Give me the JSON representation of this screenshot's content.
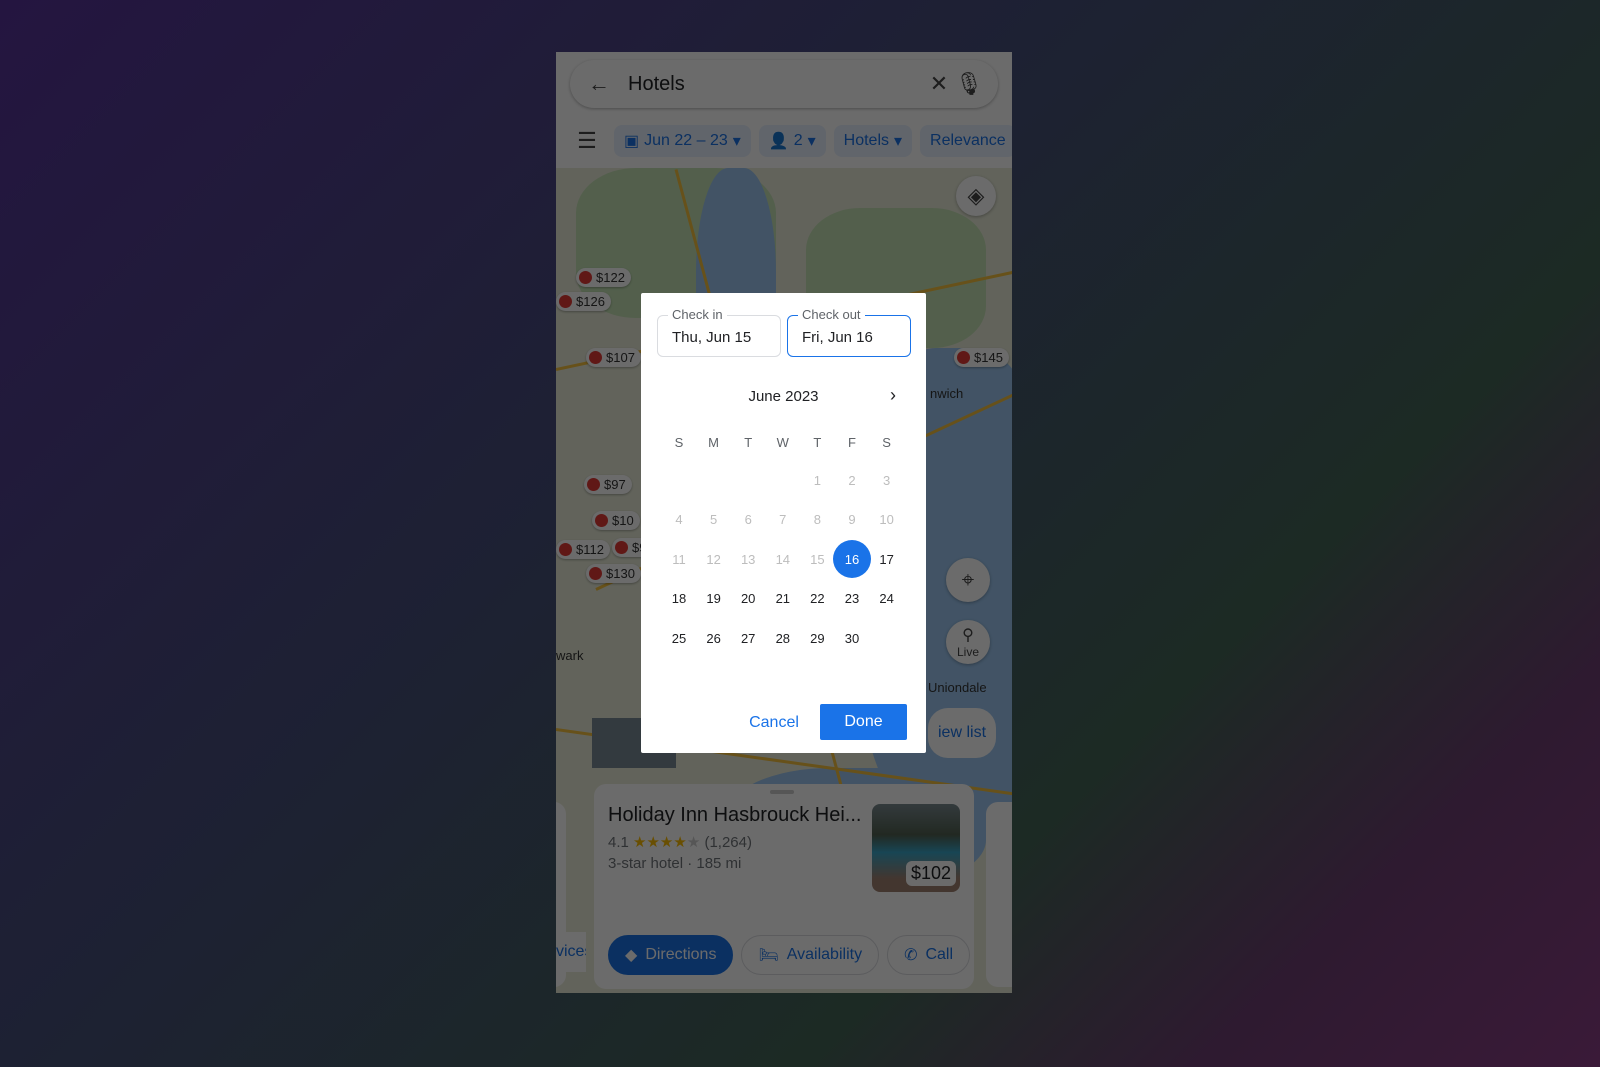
{
  "search": {
    "query": "Hotels",
    "back_icon": "arrow-left-icon",
    "clear_icon": "close-icon",
    "mic_icon": "mic-icon"
  },
  "chips": [
    {
      "label": "Jun 22 – 23",
      "icon": "calendar-icon"
    },
    {
      "label": "2",
      "icon": "person-icon"
    },
    {
      "label": "Hotels"
    },
    {
      "label": "Relevance"
    }
  ],
  "map": {
    "pins": [
      "$122",
      "$126",
      "$107",
      "$145",
      "$97",
      "$10",
      "$112",
      "$9",
      "$130"
    ],
    "labels": [
      "nwich",
      "wark",
      "Uniondale"
    ],
    "live_label": "Live",
    "view_list": "iew list"
  },
  "card": {
    "name": "Holiday Inn Hasbrouck Hei...",
    "rating": "4.1",
    "stars": "★★★★",
    "star_empty": "★",
    "reviews": "(1,264)",
    "subtitle": "3-star hotel · 185 mi",
    "price": "$102",
    "actions": {
      "partial": "vices",
      "directions": "Directions",
      "availability": "Availability",
      "call": "Call"
    }
  },
  "dialog": {
    "check_in_label": "Check in",
    "check_in": "Thu, Jun 15",
    "check_out_label": "Check out",
    "check_out": "Fri, Jun 16",
    "month": "June 2023",
    "weekdays": [
      "S",
      "M",
      "T",
      "W",
      "T",
      "F",
      "S"
    ],
    "first_weekday": 4,
    "days_in_month": 30,
    "disabled_before": 16,
    "selected": 16,
    "cancel": "Cancel",
    "done": "Done"
  },
  "colors": {
    "accent": "#1a73e8"
  }
}
